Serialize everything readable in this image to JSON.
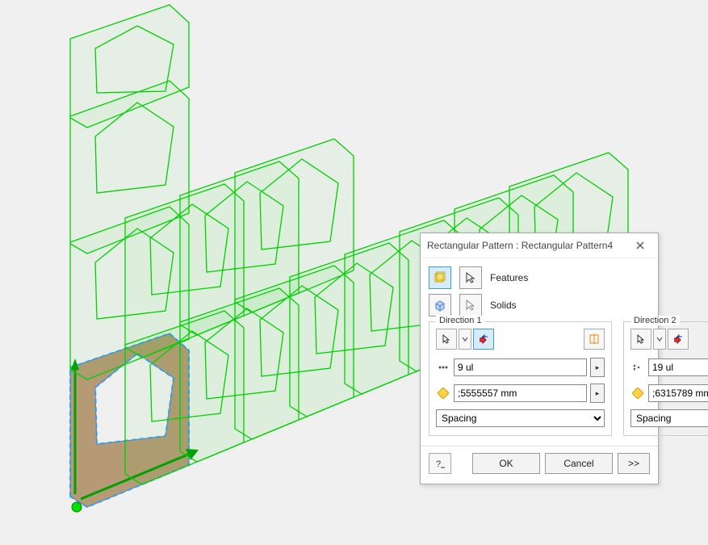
{
  "dialog": {
    "title": "Rectangular Pattern : Rectangular Pattern4",
    "features_label": "Features",
    "solids_label": "Solids",
    "dir1": {
      "group": "Direction 1",
      "count": "9 ul",
      "spacing": ";5555557 mm",
      "mode": "Spacing"
    },
    "dir2": {
      "group": "Direction 2",
      "count": "19 ul",
      "spacing": ";6315789 mm",
      "mode": "Spacing"
    },
    "ok": "OK",
    "cancel": "Cancel",
    "more": ">>"
  }
}
